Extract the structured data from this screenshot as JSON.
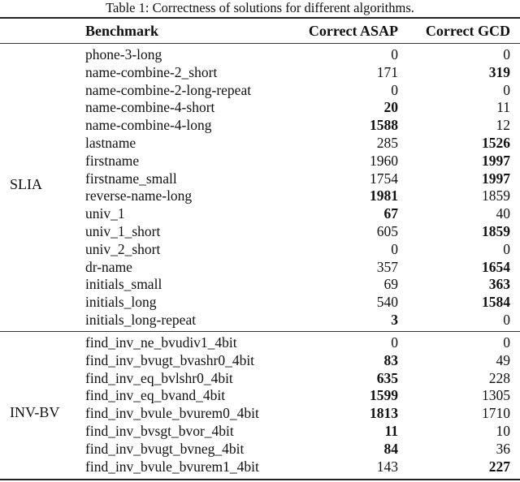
{
  "caption": "Table 1: Correctness of solutions for different algorithms.",
  "columns": {
    "benchmark": "Benchmark",
    "asap": "Correct ASAP",
    "gcd": "Correct GCD"
  },
  "groups": [
    {
      "label": "SLIA",
      "rows": [
        {
          "benchmark": "phone-3-long",
          "asap": "0",
          "gcd": "0",
          "best": "none"
        },
        {
          "benchmark": "name-combine-2_short",
          "asap": "171",
          "gcd": "319",
          "best": "gcd"
        },
        {
          "benchmark": "name-combine-2-long-repeat",
          "asap": "0",
          "gcd": "0",
          "best": "none"
        },
        {
          "benchmark": "name-combine-4-short",
          "asap": "20",
          "gcd": "11",
          "best": "asap"
        },
        {
          "benchmark": "name-combine-4-long",
          "asap": "1588",
          "gcd": "12",
          "best": "asap"
        },
        {
          "benchmark": "lastname",
          "asap": "285",
          "gcd": "1526",
          "best": "gcd"
        },
        {
          "benchmark": "firstname",
          "asap": "1960",
          "gcd": "1997",
          "best": "gcd"
        },
        {
          "benchmark": "firstname_small",
          "asap": "1754",
          "gcd": "1997",
          "best": "gcd"
        },
        {
          "benchmark": "reverse-name-long",
          "asap": "1981",
          "gcd": "1859",
          "best": "asap"
        },
        {
          "benchmark": "univ_1",
          "asap": "67",
          "gcd": "40",
          "best": "asap"
        },
        {
          "benchmark": "univ_1_short",
          "asap": "605",
          "gcd": "1859",
          "best": "gcd"
        },
        {
          "benchmark": "univ_2_short",
          "asap": "0",
          "gcd": "0",
          "best": "none"
        },
        {
          "benchmark": "dr-name",
          "asap": "357",
          "gcd": "1654",
          "best": "gcd"
        },
        {
          "benchmark": "initials_small",
          "asap": "69",
          "gcd": "363",
          "best": "gcd"
        },
        {
          "benchmark": "initials_long",
          "asap": "540",
          "gcd": "1584",
          "best": "gcd"
        },
        {
          "benchmark": "initials_long-repeat",
          "asap": "3",
          "gcd": "0",
          "best": "asap"
        }
      ]
    },
    {
      "label": "INV-BV",
      "rows": [
        {
          "benchmark": "find_inv_ne_bvudiv1_4bit",
          "asap": "0",
          "gcd": "0",
          "best": "none"
        },
        {
          "benchmark": "find_inv_bvugt_bvashr0_4bit",
          "asap": "83",
          "gcd": "49",
          "best": "asap"
        },
        {
          "benchmark": "find_inv_eq_bvlshr0_4bit",
          "asap": "635",
          "gcd": "228",
          "best": "asap"
        },
        {
          "benchmark": "find_inv_eq_bvand_4bit",
          "asap": "1599",
          "gcd": "1305",
          "best": "asap"
        },
        {
          "benchmark": "find_inv_bvule_bvurem0_4bit",
          "asap": "1813",
          "gcd": "1710",
          "best": "asap"
        },
        {
          "benchmark": "find_inv_bvsgt_bvor_4bit",
          "asap": "11",
          "gcd": "10",
          "best": "asap"
        },
        {
          "benchmark": "find_inv_bvugt_bvneg_4bit",
          "asap": "84",
          "gcd": "36",
          "best": "asap"
        },
        {
          "benchmark": "find_inv_bvule_bvurem1_4bit",
          "asap": "143",
          "gcd": "227",
          "best": "gcd"
        }
      ]
    }
  ]
}
